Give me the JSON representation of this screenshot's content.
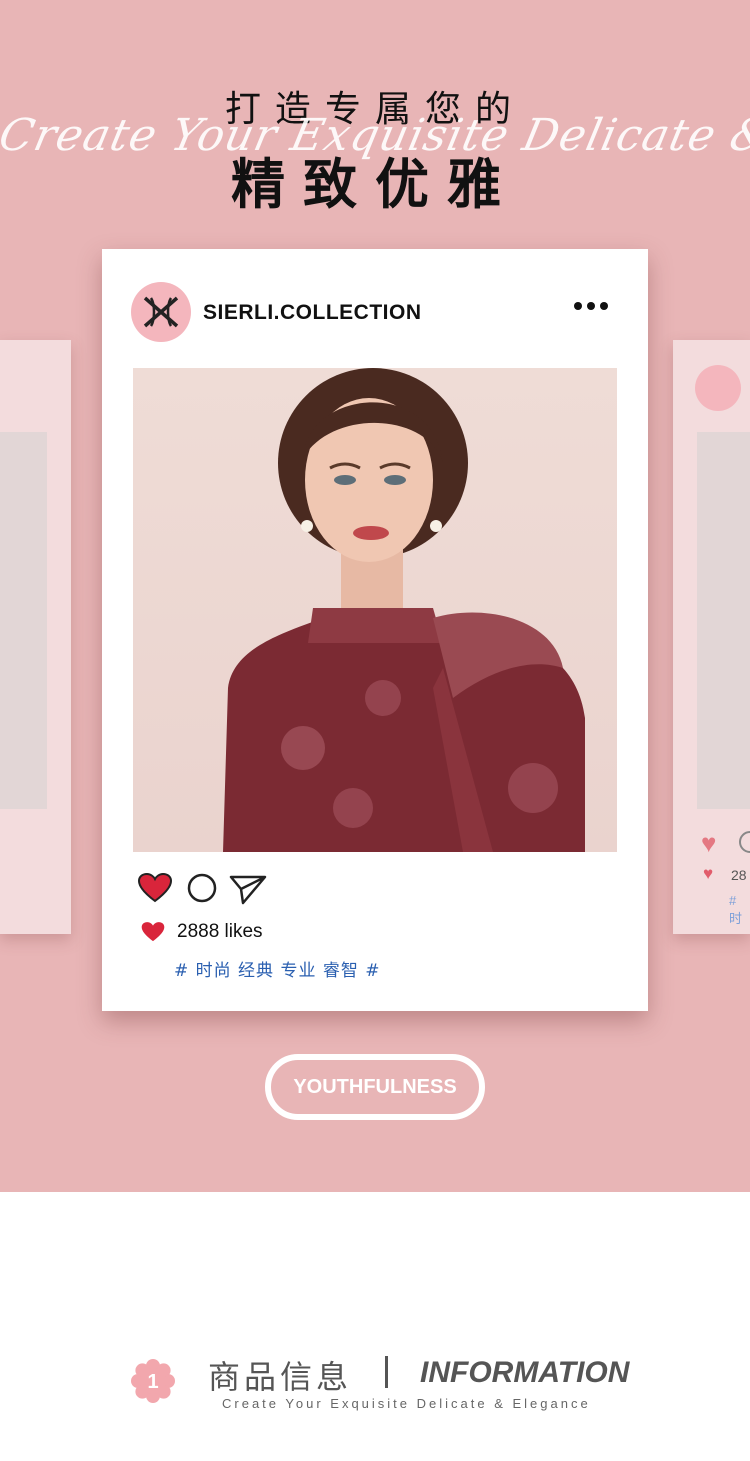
{
  "header": {
    "cn_line1": "打造专属您的",
    "script_line": "Create Your Exquisite Delicate & Elegance",
    "cn_line2": "精致优雅"
  },
  "post": {
    "username": "SIERLI.COLLECTION",
    "likes": "2888 likes",
    "hashtags": "# 时尚 经典 专业 睿智 #"
  },
  "side_post": {
    "likes_partial": "28",
    "hashtag_partial": "# 时"
  },
  "youthfulness_button": "YOUTHFULNESS",
  "info_section": {
    "badge_number": "1",
    "title_cn": "商品信息",
    "title_en": "INFORMATION",
    "subtitle": "Create Your Exquisite Delicate & Elegance"
  },
  "colors": {
    "background_pink": "#e8b5b6",
    "heart_red": "#d9253b",
    "hashtag_blue": "#2a5fb0"
  },
  "icons": [
    "more-icon",
    "heart-icon",
    "comment-icon",
    "share-icon",
    "heart-small-icon",
    "logo-icon",
    "flower-badge-icon"
  ]
}
